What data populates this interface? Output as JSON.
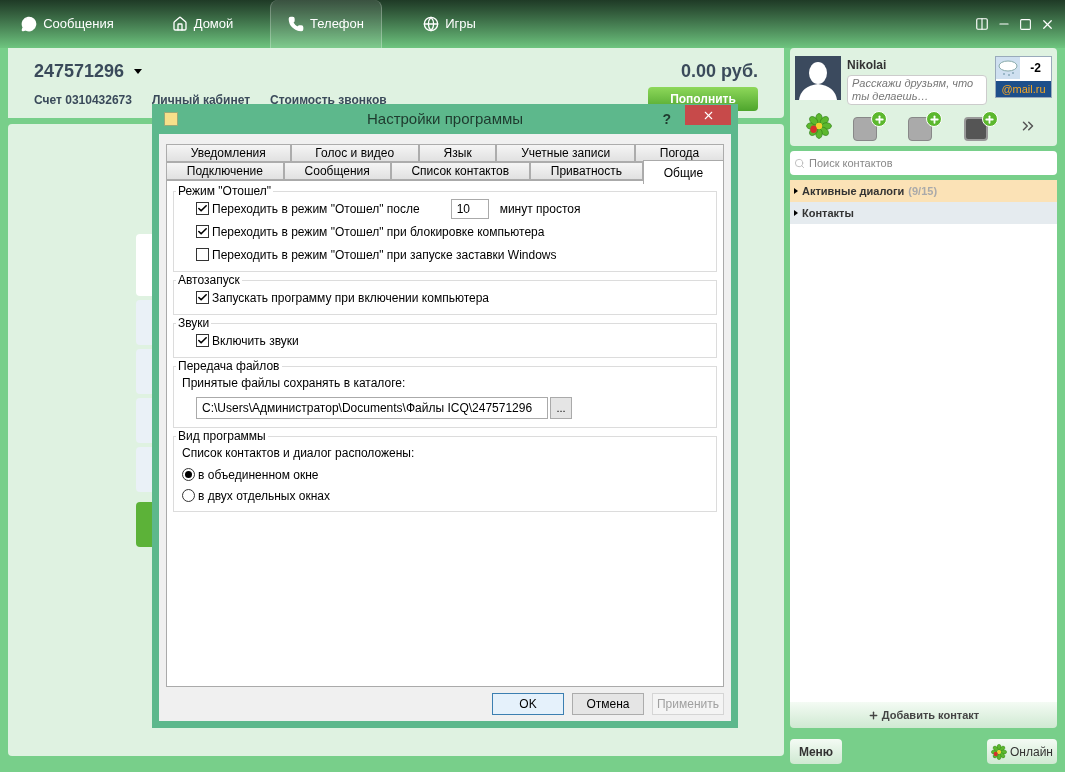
{
  "top_tabs": [
    {
      "label": "Сообщения",
      "kind": "chat",
      "selected": false
    },
    {
      "label": "Домой",
      "kind": "home",
      "selected": false
    },
    {
      "label": "Телефон",
      "kind": "phone",
      "selected": true
    },
    {
      "label": "Игры",
      "kind": "globe",
      "selected": false
    }
  ],
  "account": {
    "number": "247571296",
    "balance": "0.00 руб.",
    "links": [
      "Счет 0310432673",
      "Личный кабинет",
      "Стоимость звонков"
    ],
    "top_up": "Пополнить"
  },
  "profile": {
    "name": "Nikolai",
    "status_placeholder": "Расскажи друзьям, что ты делаешь…",
    "temperature": "-2",
    "weather_source": "@mail.ru"
  },
  "search": {
    "placeholder": "Поиск контактов"
  },
  "groups": [
    {
      "label": "Активные диалоги",
      "count": "(9/15)",
      "selected": true
    },
    {
      "label": "Контакты",
      "selected": false
    }
  ],
  "add_contact": "Добавить контакт",
  "menu_button": "Меню",
  "status_button": "Онлайн",
  "dialog": {
    "title": "Настройки программы",
    "help": "?",
    "tab_rows": [
      [
        {
          "label": "Уведомления",
          "selected": false
        },
        {
          "label": "Голос и видео",
          "selected": false
        },
        {
          "label": "Язык",
          "selected": false
        },
        {
          "label": "Учетные записи",
          "selected": false
        },
        {
          "label": "Погода",
          "selected": false
        }
      ],
      [
        {
          "label": "Подключение",
          "selected": false
        },
        {
          "label": "Сообщения",
          "selected": false
        },
        {
          "label": "Список контактов",
          "selected": false
        },
        {
          "label": "Приватность",
          "selected": false
        },
        {
          "label": "Общие",
          "selected": true
        }
      ]
    ],
    "sections": [
      {
        "title": "Режим \"Отошел\"",
        "items": [
          {
            "kind": "checkbox",
            "label": "Переходить в режим \"Отошел\" после",
            "checked": true,
            "value": "10",
            "suffix": "минут простоя"
          },
          {
            "kind": "checkbox",
            "label": "Переходить в режим \"Отошел\" при блокировке компьютера",
            "checked": true
          },
          {
            "kind": "checkbox",
            "label": "Переходить в режим \"Отошел\" при запуске заставки Windows",
            "checked": false
          }
        ]
      },
      {
        "title": "Автозапуск",
        "items": [
          {
            "kind": "checkbox",
            "label": "Запускать программу при включении компьютера",
            "checked": true
          }
        ]
      },
      {
        "title": "Звуки",
        "items": [
          {
            "kind": "checkbox",
            "label": "Включить звуки",
            "checked": true
          }
        ]
      },
      {
        "title": "Передача файлов",
        "items": [
          {
            "kind": "text",
            "label": "Принятые файлы сохранять в каталоге:"
          },
          {
            "kind": "path",
            "value": "C:\\Users\\Администратор\\Documents\\Файлы ICQ\\247571296",
            "browse": "..."
          }
        ]
      },
      {
        "title": "Вид программы",
        "items": [
          {
            "kind": "text",
            "label": "Список контактов и диалог расположены:"
          },
          {
            "kind": "radio",
            "label": "в объединенном окне",
            "selected": true
          },
          {
            "kind": "radio",
            "label": "в двух отдельных окнах",
            "selected": false
          }
        ]
      }
    ],
    "buttons": [
      {
        "label": "OK",
        "kind": "default",
        "disabled": false
      },
      {
        "label": "Отмена",
        "kind": "normal",
        "disabled": false
      },
      {
        "label": "Применить",
        "kind": "normal",
        "disabled": true
      }
    ]
  }
}
